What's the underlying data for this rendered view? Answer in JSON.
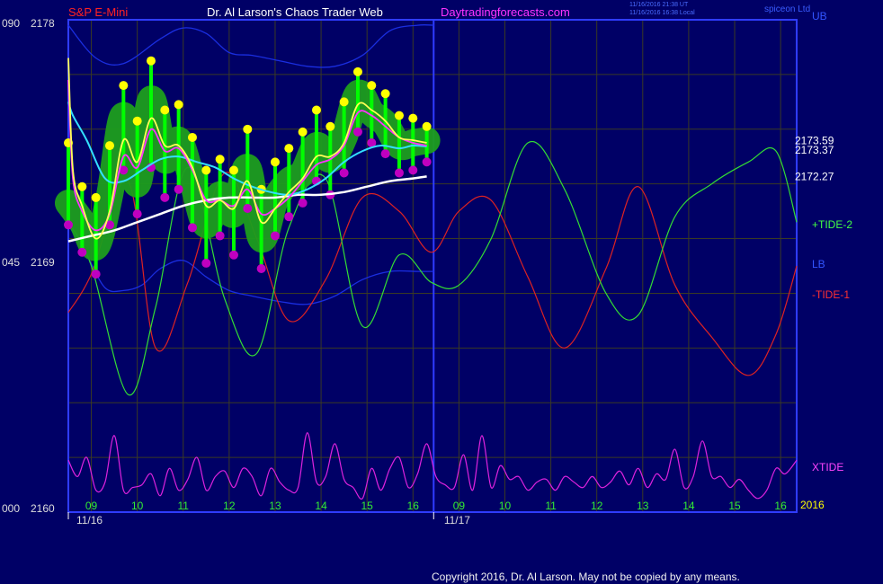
{
  "header": {
    "symbol": "S&P E-Mini",
    "title": "Dr. Al Larson's Chaos Trader Web",
    "site": "Daytradingforecasts.com",
    "stamp_utc": "11/16/2016 21:38 UT",
    "stamp_local": "11/16/2016 16:38 Local",
    "brand": "spiceon Ltd",
    "copyright": "Copyright 2016, Dr. Al Larson. May not be copied by any means."
  },
  "colors": {
    "background": "#000066",
    "frame": "#2f3cff",
    "grid": "#3a3a24",
    "price_bar": "#00ff00",
    "halo": "#1e9e1e",
    "high_dot": "#ffff00",
    "low_dot": "#c000c0",
    "fast_avg": "#ffff55",
    "mid_avg": "#ff33ff",
    "cyan_avg": "#33e0ff",
    "slow_avg": "#ffffff",
    "tide2": "#33dd33",
    "tide1": "#dd2222",
    "band": "#1a2ee0",
    "xtide": "#dd22dd",
    "xtide_label": "#ff44ff",
    "lb_label": "#3355ff",
    "tide1_label": "#ff3030",
    "tide2_label": "#44ff44",
    "xaxis_label": "#33ee33",
    "yaxis_label": "#dddddd",
    "header_symbol": "#ff2222",
    "header_title": "#ffffff",
    "header_site": "#ff33ff"
  },
  "chart_data": {
    "type": "line",
    "y_axis": {
      "tick_labels": [
        {
          "left": "090",
          "right": "2178",
          "value": 2178
        },
        {
          "left": "045",
          "right": "2169",
          "value": 2169
        },
        {
          "left": "000",
          "right": "2160",
          "value": 2160
        }
      ],
      "ylim": [
        2160,
        2178
      ]
    },
    "x_axis": {
      "hour_ticks": [
        {
          "label": "09",
          "t": 0.5
        },
        {
          "label": "10",
          "t": 1.5
        },
        {
          "label": "11",
          "t": 2.5
        },
        {
          "label": "12",
          "t": 3.5
        },
        {
          "label": "13",
          "t": 4.5
        },
        {
          "label": "14",
          "t": 5.5
        },
        {
          "label": "15",
          "t": 6.5
        },
        {
          "label": "16",
          "t": 7.5
        },
        {
          "label": "09",
          "t": 8.5
        },
        {
          "label": "10",
          "t": 9.5
        },
        {
          "label": "11",
          "t": 10.5
        },
        {
          "label": "12",
          "t": 11.5
        },
        {
          "label": "13",
          "t": 12.5
        },
        {
          "label": "14",
          "t": 13.5
        },
        {
          "label": "15",
          "t": 14.5
        },
        {
          "label": "16",
          "t": 15.5
        }
      ],
      "day_labels": [
        {
          "label": "11/16",
          "t": 0.5
        },
        {
          "label": "11/17",
          "t": 8.5
        }
      ],
      "year_label": "2016",
      "xlim": [
        0,
        15.85
      ],
      "day_divider_t": 7.95
    },
    "grid": true,
    "price_labels": [
      {
        "text": "2173.59",
        "value": 2173.59
      },
      {
        "text": "2173.37",
        "value": 2173.37
      },
      {
        "text": "2172.27",
        "value": 2172.27
      }
    ],
    "price": {
      "t": [
        0,
        0.3,
        0.6,
        0.9,
        1.2,
        1.5,
        1.8,
        2.1,
        2.4,
        2.7,
        3.0,
        3.3,
        3.6,
        3.9,
        4.2,
        4.5,
        4.8,
        5.1,
        5.4,
        5.7,
        6.0,
        6.3,
        6.6,
        6.9,
        7.2,
        7.5,
        7.8
      ],
      "close": [
        2171.3,
        2170.6,
        2169.7,
        2171.6,
        2174.5,
        2172.0,
        2175.1,
        2172.9,
        2173.6,
        2172.1,
        2170.5,
        2171.6,
        2170.9,
        2172.6,
        2170.0,
        2171.4,
        2172.1,
        2172.4,
        2173.4,
        2172.9,
        2173.7,
        2175.3,
        2174.6,
        2174.2,
        2173.4,
        2173.5,
        2173.59
      ],
      "high": [
        2173.4,
        2171.8,
        2171.4,
        2173.3,
        2175.5,
        2174.2,
        2176.4,
        2174.6,
        2174.8,
        2173.6,
        2172.4,
        2172.8,
        2172.4,
        2173.9,
        2171.7,
        2172.7,
        2173.2,
        2173.8,
        2174.6,
        2174.0,
        2174.9,
        2176.0,
        2175.5,
        2175.2,
        2174.4,
        2174.3,
        2174.0
      ],
      "low": [
        2170.6,
        2169.6,
        2168.8,
        2170.6,
        2172.6,
        2171.0,
        2172.7,
        2171.6,
        2171.9,
        2170.5,
        2169.2,
        2170.2,
        2169.5,
        2171.2,
        2169.0,
        2170.2,
        2170.9,
        2171.4,
        2172.2,
        2171.7,
        2172.5,
        2174.0,
        2173.6,
        2173.2,
        2172.5,
        2172.6,
        2172.9
      ]
    },
    "series": [
      {
        "name": "",
        "role": "fast_avg",
        "t": [
          0,
          0.1,
          0.3,
          0.6,
          0.9,
          1.2,
          1.5,
          1.8,
          2.1,
          2.4,
          2.7,
          3.0,
          3.3,
          3.6,
          3.9,
          4.2,
          4.5,
          4.8,
          5.1,
          5.4,
          5.7,
          6.0,
          6.3,
          6.6,
          6.9,
          7.2,
          7.5,
          7.8
        ],
        "values": [
          2176.6,
          2172.5,
          2171.2,
          2170.0,
          2171.0,
          2173.6,
          2172.8,
          2174.4,
          2173.4,
          2173.4,
          2172.6,
          2171.2,
          2171.4,
          2171.1,
          2172.1,
          2170.6,
          2171.1,
          2171.7,
          2172.2,
          2173.0,
          2173.0,
          2173.5,
          2174.9,
          2174.7,
          2174.3,
          2173.7,
          2173.6,
          2173.5
        ]
      },
      {
        "name": "",
        "role": "mid_avg",
        "t": [
          0,
          0.1,
          0.3,
          0.6,
          0.9,
          1.2,
          1.5,
          1.8,
          2.1,
          2.4,
          2.7,
          3.0,
          3.3,
          3.6,
          3.9,
          4.2,
          4.5,
          4.8,
          5.1,
          5.4,
          5.7,
          6.0,
          6.3,
          6.6,
          6.9,
          7.2,
          7.5,
          7.8
        ],
        "values": [
          2175.8,
          2172.2,
          2171.0,
          2170.3,
          2170.9,
          2173.0,
          2172.6,
          2174.0,
          2173.2,
          2173.3,
          2172.5,
          2171.4,
          2171.4,
          2171.2,
          2171.8,
          2170.9,
          2171.1,
          2171.5,
          2172.1,
          2172.7,
          2172.9,
          2173.4,
          2174.6,
          2174.5,
          2174.1,
          2173.7,
          2173.5,
          2173.4
        ]
      },
      {
        "name": "",
        "role": "cyan_avg",
        "t": [
          0,
          0.1,
          0.4,
          0.8,
          1.2,
          1.6,
          2.0,
          2.4,
          2.8,
          3.2,
          3.6,
          4.0,
          4.4,
          4.8,
          5.2,
          5.6,
          6.0,
          6.4,
          6.8,
          7.2,
          7.5,
          7.8
        ],
        "values": [
          2175.0,
          2174.5,
          2173.6,
          2172.2,
          2172.1,
          2172.5,
          2172.9,
          2173.0,
          2172.8,
          2172.6,
          2172.2,
          2171.9,
          2171.7,
          2171.6,
          2171.8,
          2172.2,
          2172.8,
          2173.2,
          2173.4,
          2173.3,
          2173.4,
          2173.37
        ]
      },
      {
        "name": "",
        "role": "slow_avg",
        "t": [
          0,
          0.5,
          1.0,
          1.5,
          2.0,
          2.5,
          3.0,
          3.5,
          4.0,
          4.5,
          5.0,
          5.5,
          6.0,
          6.5,
          7.0,
          7.5,
          7.8
        ],
        "values": [
          2169.9,
          2170.1,
          2170.3,
          2170.6,
          2170.9,
          2171.2,
          2171.4,
          2171.5,
          2171.5,
          2171.5,
          2171.6,
          2171.6,
          2171.7,
          2171.9,
          2172.1,
          2172.2,
          2172.27
        ]
      },
      {
        "name": "+TIDE-2",
        "role": "tide2",
        "t": [
          0,
          0.5,
          1.3,
          1.9,
          2.6,
          3.4,
          4.1,
          4.8,
          5.6,
          6.4,
          7.2,
          7.9,
          8.5,
          9.2,
          10.0,
          10.8,
          11.7,
          12.4,
          13.2,
          14.0,
          14.8,
          15.4,
          15.85
        ],
        "values": [
          2170.6,
          2169.0,
          2164.3,
          2167.5,
          2172.6,
          2167.8,
          2165.8,
          2170.4,
          2172.2,
          2166.8,
          2169.4,
          2168.4,
          2168.3,
          2170.0,
          2173.5,
          2171.8,
          2168.0,
          2167.2,
          2170.8,
          2172.0,
          2172.8,
          2173.2,
          2170.6
        ]
      },
      {
        "name": "-TIDE-1",
        "role": "tide1",
        "t": [
          0,
          0.5,
          1.3,
          1.9,
          2.6,
          3.4,
          4.1,
          4.8,
          5.6,
          6.4,
          7.2,
          7.9,
          8.5,
          9.2,
          10.0,
          10.8,
          11.7,
          12.4,
          13.2,
          14.0,
          14.8,
          15.4,
          15.85
        ],
        "values": [
          2167.3,
          2168.7,
          2172.1,
          2166.0,
          2168.4,
          2172.4,
          2170.0,
          2167.0,
          2168.5,
          2171.5,
          2171.0,
          2169.5,
          2171.0,
          2171.4,
          2168.6,
          2166.0,
          2168.9,
          2171.9,
          2168.3,
          2166.4,
          2165.0,
          2166.5,
          2169.0
        ]
      },
      {
        "name": "UB",
        "role": "band",
        "t": [
          0,
          0.6,
          1.2,
          2.0,
          2.5,
          3.0,
          3.5,
          4.0,
          4.6,
          5.2,
          5.8,
          6.4,
          7.0,
          7.6,
          7.95
        ],
        "values": [
          2177.8,
          2176.6,
          2176.4,
          2177.3,
          2177.7,
          2177.5,
          2176.8,
          2176.7,
          2176.5,
          2176.3,
          2176.3,
          2176.7,
          2177.6,
          2177.8,
          2177.8
        ]
      },
      {
        "name": "LB",
        "role": "band",
        "t": [
          0,
          0.4,
          0.8,
          1.2,
          1.6,
          2.0,
          2.5,
          3.0,
          3.5,
          4.0,
          4.6,
          5.2,
          5.8,
          6.4,
          7.0,
          7.6,
          7.95
        ],
        "values": [
          2170.5,
          2169.4,
          2168.2,
          2168.1,
          2168.3,
          2168.9,
          2169.2,
          2168.6,
          2168.1,
          2167.9,
          2167.7,
          2167.6,
          2167.9,
          2168.5,
          2168.8,
          2168.8,
          2168.8
        ]
      },
      {
        "name": "XTIDE",
        "role": "xtide",
        "t": [
          0,
          0.2,
          0.4,
          0.6,
          0.8,
          1.0,
          1.2,
          1.4,
          1.6,
          1.8,
          2.0,
          2.2,
          2.4,
          2.6,
          2.8,
          3.0,
          3.2,
          3.4,
          3.6,
          3.8,
          4.0,
          4.2,
          4.4,
          4.6,
          4.8,
          5.0,
          5.2,
          5.4,
          5.6,
          5.8,
          6.0,
          6.2,
          6.4,
          6.6,
          6.8,
          7.0,
          7.2,
          7.4,
          7.6,
          7.8,
          8.0,
          8.2,
          8.4,
          8.6,
          8.8,
          9.0,
          9.2,
          9.4,
          9.6,
          9.8,
          10.0,
          10.2,
          10.4,
          10.6,
          10.8,
          11.0,
          11.2,
          11.4,
          11.6,
          11.8,
          12.0,
          12.2,
          12.4,
          12.6,
          12.8,
          13.0,
          13.2,
          13.4,
          13.6,
          13.8,
          14.0,
          14.2,
          14.4,
          14.6,
          14.8,
          15.0,
          15.2,
          15.4,
          15.6,
          15.85
        ],
        "values": [
          2161.9,
          2161.3,
          2162.0,
          2160.8,
          2161.1,
          2162.8,
          2160.8,
          2160.9,
          2161.0,
          2161.4,
          2160.6,
          2161.6,
          2160.8,
          2161.2,
          2162.0,
          2160.8,
          2161.3,
          2161.5,
          2160.9,
          2161.6,
          2161.3,
          2160.6,
          2161.6,
          2161.1,
          2160.8,
          2160.9,
          2162.9,
          2161.1,
          2161.3,
          2162.5,
          2161.2,
          2160.9,
          2160.5,
          2161.6,
          2160.8,
          2161.6,
          2162.0,
          2160.9,
          2161.4,
          2162.5,
          2161.3,
          2161.0,
          2160.9,
          2162.1,
          2160.8,
          2162.8,
          2160.9,
          2161.7,
          2161.2,
          2161.3,
          2160.8,
          2161.1,
          2161.2,
          2160.8,
          2161.3,
          2161.1,
          2160.9,
          2161.3,
          2160.9,
          2161.1,
          2161.5,
          2161.0,
          2161.6,
          2160.9,
          2161.4,
          2161.2,
          2162.3,
          2160.9,
          2161.3,
          2162.6,
          2161.3,
          2161.3,
          2160.9,
          2161.2,
          2160.8,
          2160.5,
          2160.8,
          2161.6,
          2161.4,
          2161.9
        ]
      }
    ]
  }
}
